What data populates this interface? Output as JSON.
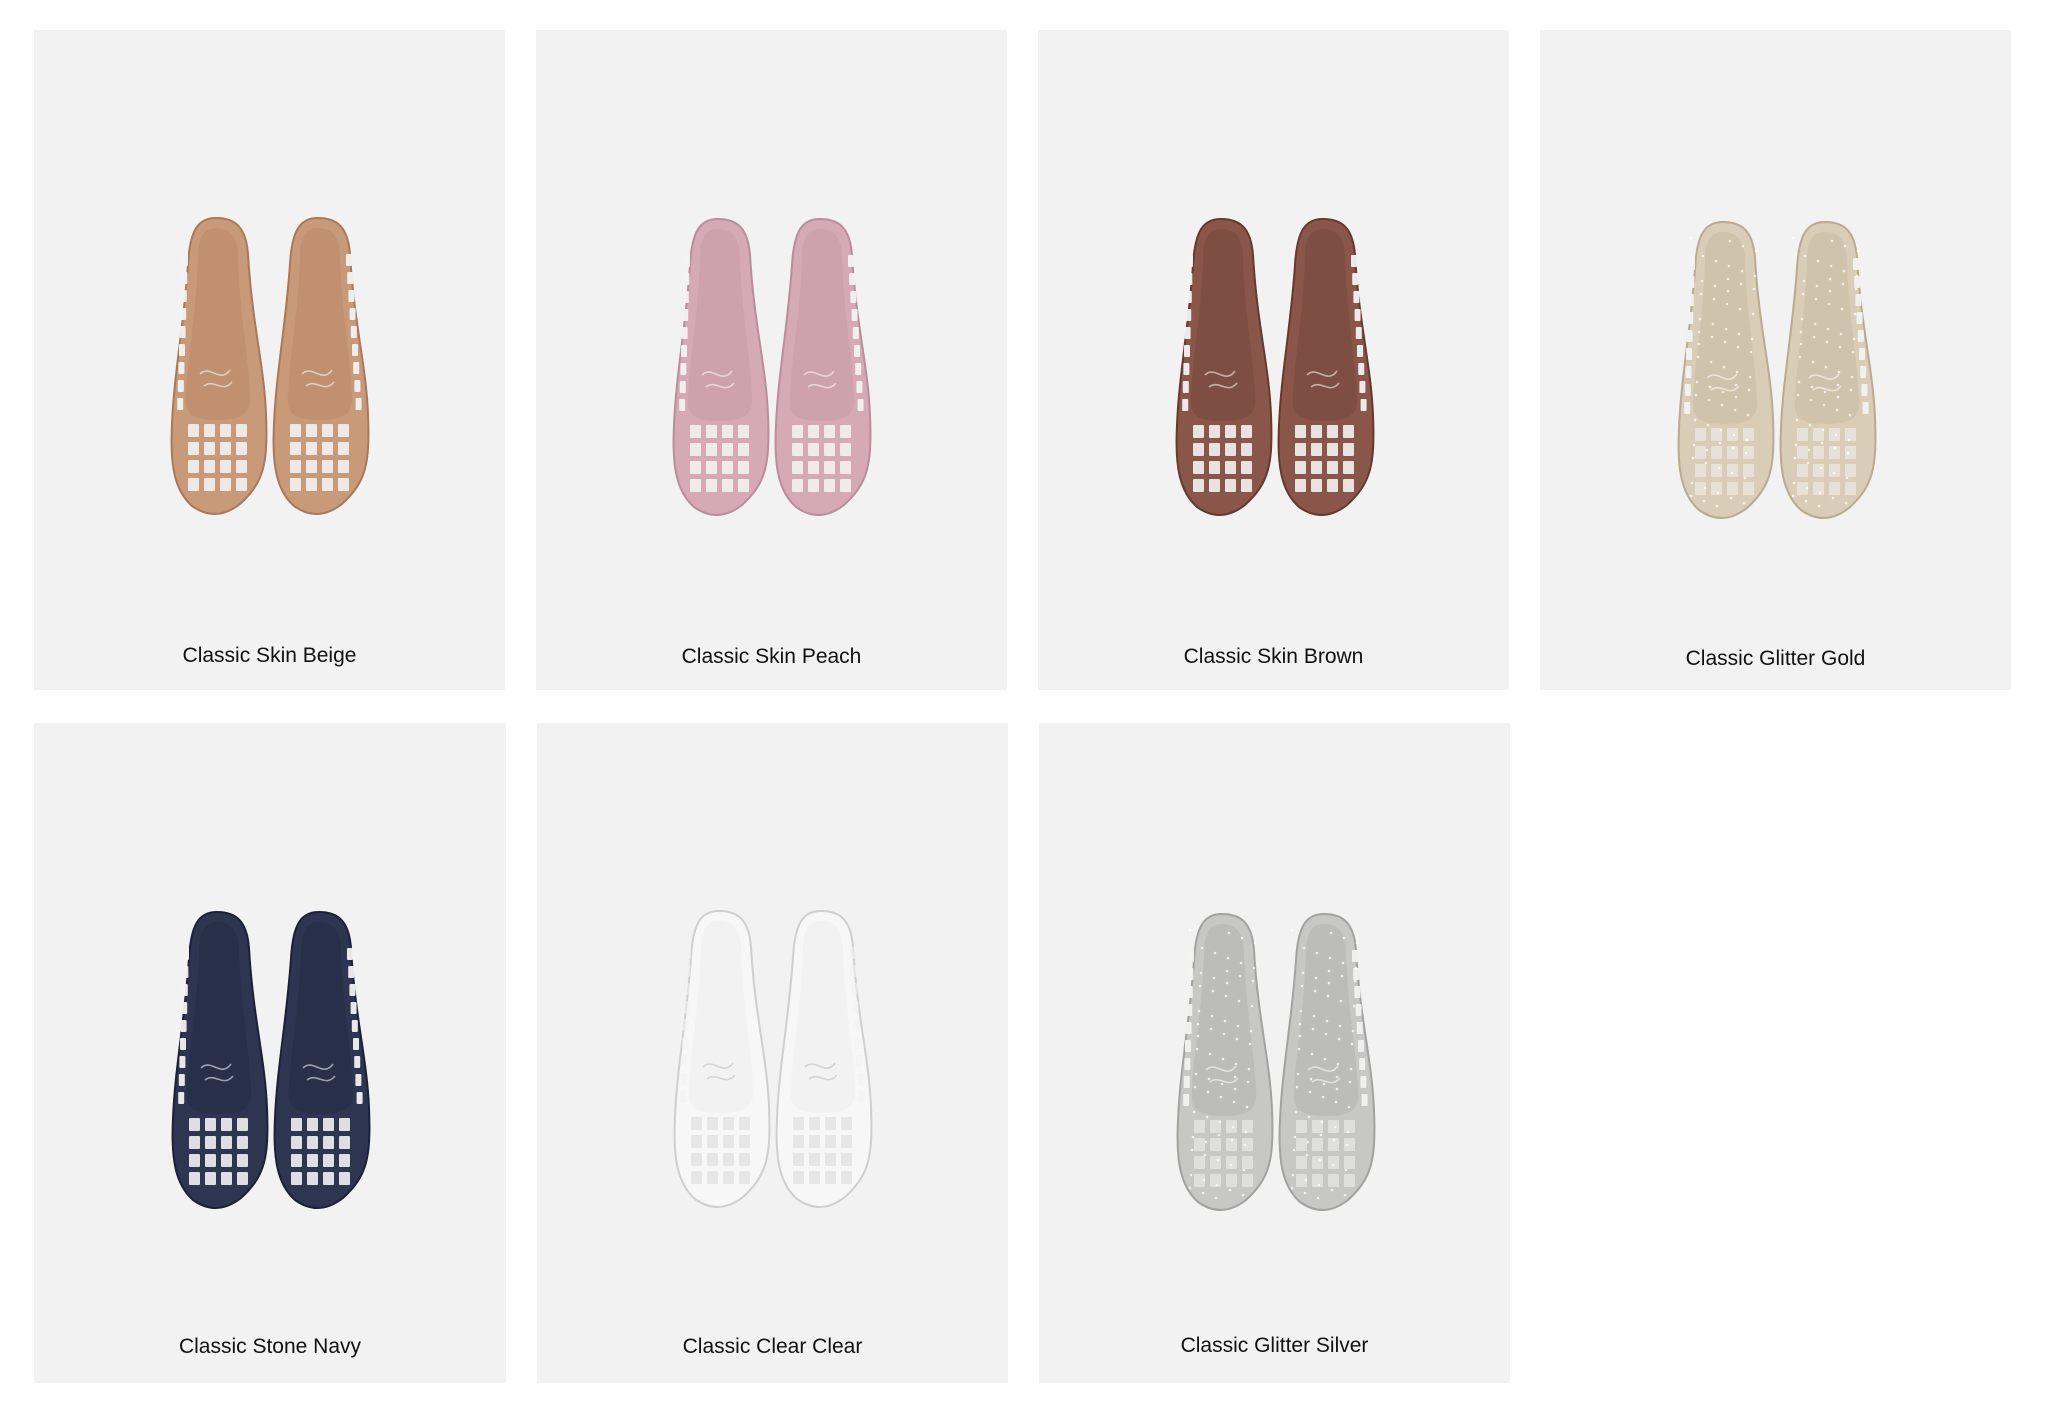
{
  "products": [
    {
      "label": "Classic Skin Beige",
      "color": "#c99a79",
      "edge": "#a9785a",
      "glitter": false,
      "clear": false
    },
    {
      "label": "Classic Skin Peach",
      "color": "#d6a9b7",
      "edge": "#b98d9c",
      "glitter": false,
      "clear": false
    },
    {
      "label": "Classic Skin Brown",
      "color": "#8a564a",
      "edge": "#66392f",
      "glitter": false,
      "clear": false
    },
    {
      "label": "Classic Glitter Gold",
      "color": "#d9cdb7",
      "edge": "#b9aa90",
      "glitter": true,
      "clear": false
    },
    {
      "label": "Classic Stone Navy",
      "color": "#2d3550",
      "edge": "#1b2238",
      "glitter": false,
      "clear": false
    },
    {
      "label": "Classic Clear Clear",
      "color": "#f4f4f4",
      "edge": "#cfcfcf",
      "glitter": false,
      "clear": true
    },
    {
      "label": "Classic Glitter Silver",
      "color": "#c7c7c5",
      "edge": "#a2a2a0",
      "glitter": true,
      "clear": false
    }
  ]
}
